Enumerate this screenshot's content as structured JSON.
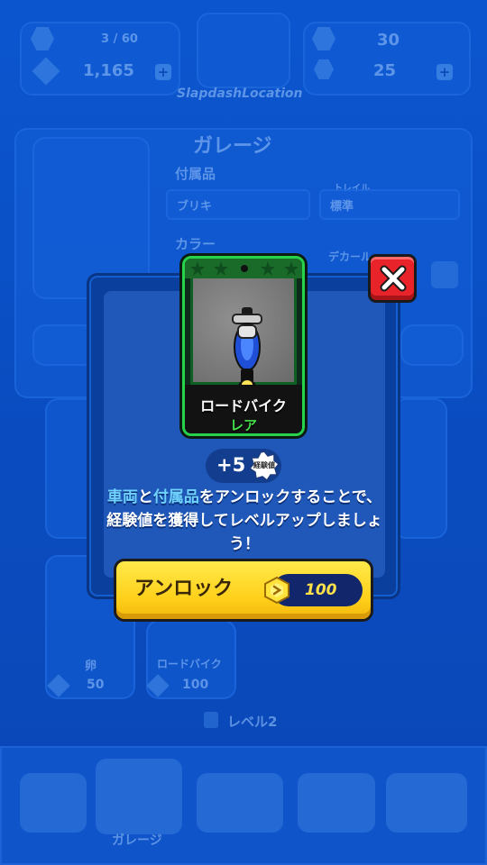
{
  "background": {
    "top_bar": {
      "trophy_progress": "3 / 60",
      "coins": "1,165",
      "gems": "30",
      "tokens": "25",
      "player_name": "SlapdashLocation"
    },
    "screen_title": "ガレージ",
    "fields": {
      "accessory_label": "付属品",
      "accessory_value": "ブリキ",
      "trail_label": "トレイル",
      "trail_value": "標準",
      "color_label": "カラー",
      "decal_value": "デカール"
    },
    "grid": {
      "item_a_label": "卵",
      "item_a_price": "50",
      "item_b_label": "ロードバイク",
      "item_b_price": "100"
    },
    "level_label": "レベル2",
    "bottom_tab": "ガレージ"
  },
  "dialog": {
    "card": {
      "name": "ロードバイク",
      "rarity": "レア"
    },
    "xp": {
      "amount": "+5",
      "label": "経験値"
    },
    "message": {
      "highlight_1": "車両",
      "text_1": "と",
      "highlight_2": "付属品",
      "text_2": "をアンロックすることで、経験値を獲得してレベルアップしましょう！"
    },
    "unlock_button": {
      "label": "アンロック",
      "price": "100"
    }
  },
  "colors": {
    "card_border": "#27d34a",
    "rarity": "#45e14a",
    "close_button": "#e9232a",
    "unlock_button": "#ffd21d",
    "highlight": "#6fd2ff"
  }
}
